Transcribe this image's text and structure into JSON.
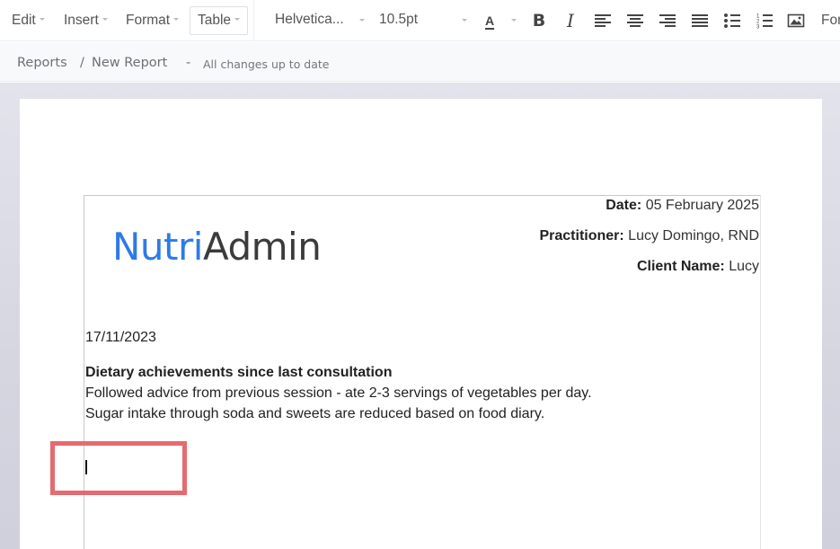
{
  "toolbar": {
    "menus": [
      {
        "label": "Edit"
      },
      {
        "label": "Insert"
      },
      {
        "label": "Format"
      },
      {
        "label": "Table",
        "active": true
      }
    ],
    "font_family": "Helvetica...",
    "font_size": "10.5pt",
    "text_color_label": "A",
    "buttons": [
      {
        "name": "bold",
        "icon": "bold-icon"
      },
      {
        "name": "italic",
        "icon": "italic-icon"
      },
      {
        "name": "align-left",
        "icon": "align-left-icon"
      },
      {
        "name": "align-center",
        "icon": "align-center-icon"
      },
      {
        "name": "align-right",
        "icon": "align-right-icon"
      },
      {
        "name": "align-justify",
        "icon": "align-justify-icon"
      },
      {
        "name": "bullet-list",
        "icon": "bullet-list-icon"
      },
      {
        "name": "numbered-list",
        "icon": "numbered-list-icon"
      },
      {
        "name": "insert-image",
        "icon": "image-icon"
      }
    ],
    "overflow_label": "For"
  },
  "breadcrumb": {
    "items": [
      "Reports",
      "New Report"
    ],
    "separator": "/",
    "dash": "-",
    "status": "All changes up to date"
  },
  "report": {
    "logo": {
      "part1": "Nutri",
      "part2": "Admin",
      "color1": "#2f7ae5",
      "color2": "#3b3b3b"
    },
    "meta": [
      {
        "label": "Date:",
        "value": "05 February 2025"
      },
      {
        "label": "Practitioner:",
        "value": "Lucy Domingo, RND"
      },
      {
        "label": "Client Name:",
        "value": "Lucy"
      }
    ],
    "entry_date": "17/11/2023",
    "section_heading": "Dietary achievements since last consultation",
    "lines": [
      "Followed advice from previous session - ate 2-3 servings of vegetables per day.",
      "Sugar intake through soda and sweets are reduced based on food diary."
    ]
  },
  "annotation": {
    "highlight_color": "#e46b70"
  }
}
